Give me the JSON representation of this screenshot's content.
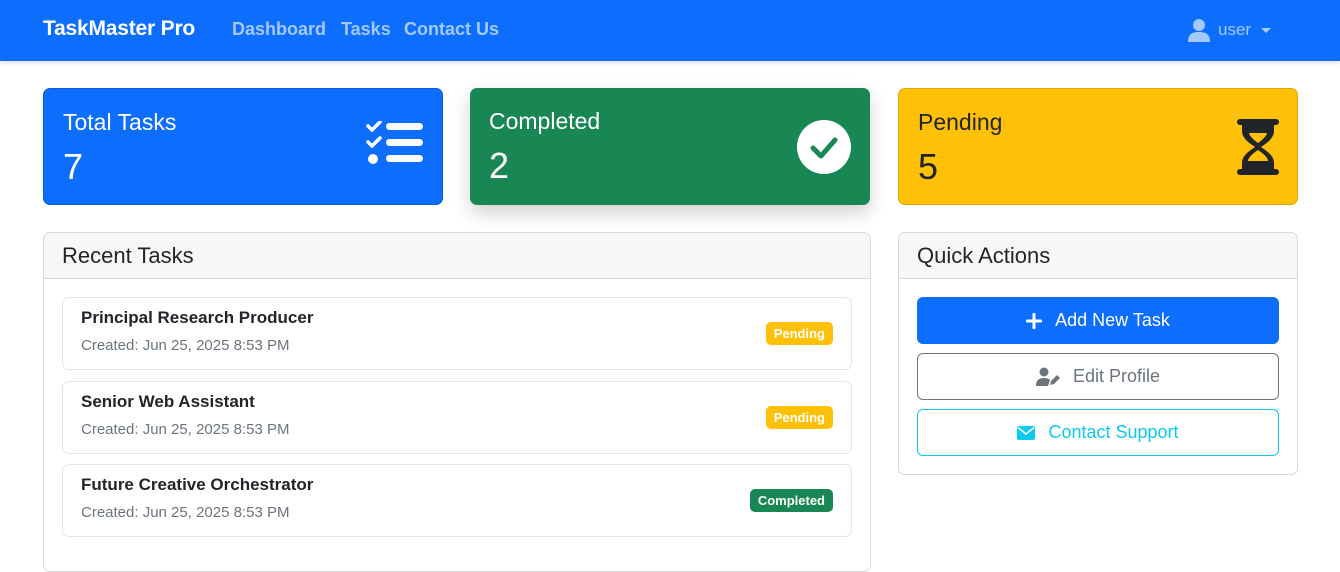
{
  "navbar": {
    "brand": "TaskMaster Pro",
    "links": [
      "Dashboard",
      "Tasks",
      "Contact Us"
    ],
    "user_label": "user",
    "user_icon": "user-icon"
  },
  "stats": [
    {
      "title": "Total Tasks",
      "value": "7",
      "icon": "tasks-list-icon",
      "color": "#0d6efd"
    },
    {
      "title": "Completed",
      "value": "2",
      "icon": "check-circle-icon",
      "color": "#198754"
    },
    {
      "title": "Pending",
      "value": "5",
      "icon": "hourglass-icon",
      "color": "#ffc107"
    }
  ],
  "recent_tasks": {
    "header": "Recent Tasks",
    "items": [
      {
        "title": "Principal Research Producer",
        "created": "Created: Jun 25, 2025 8:53 PM",
        "status": "Pending"
      },
      {
        "title": "Senior Web Assistant",
        "created": "Created: Jun 25, 2025 8:53 PM",
        "status": "Pending"
      },
      {
        "title": "Future Creative Orchestrator",
        "created": "Created: Jun 25, 2025 8:53 PM",
        "status": "Completed"
      }
    ]
  },
  "quick_actions": {
    "header": "Quick Actions",
    "add_task": "Add New Task",
    "edit_profile": "Edit Profile",
    "contact_support": "Contact Support"
  },
  "colors": {
    "primary": "#0d6efd",
    "success": "#198754",
    "warning": "#ffc107",
    "info": "#0dcaf0",
    "secondary": "#6c757d"
  }
}
